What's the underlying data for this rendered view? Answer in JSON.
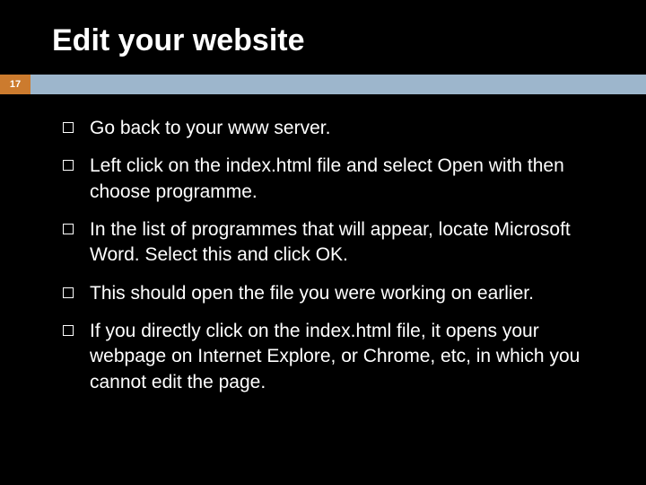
{
  "slide": {
    "title": "Edit your website",
    "page_number": "17",
    "accent_color": "#cc7b2e",
    "stripe_color": "#9db6cc",
    "bullets": [
      "Go back to your www server.",
      "Left click on the index.html file and select Open with then choose programme.",
      "In the list of programmes that will appear, locate Microsoft Word. Select this and click OK.",
      "This should open the file you were working on earlier.",
      "If you directly click on the index.html file, it opens your webpage on Internet Explore, or Chrome, etc, in which you cannot edit the page."
    ]
  }
}
